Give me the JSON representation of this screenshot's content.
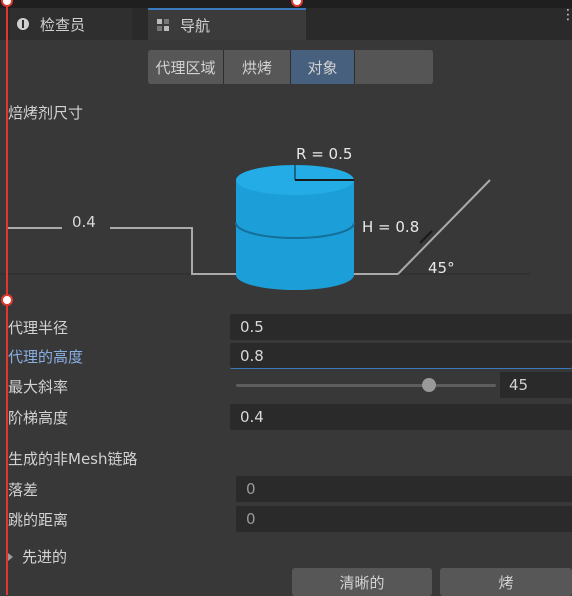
{
  "tabs": [
    {
      "label": "检查员"
    },
    {
      "label": "导航"
    }
  ],
  "segments": [
    "代理区域",
    "烘烤",
    "对象",
    ""
  ],
  "section_bake_title": "焙烤剂尺寸",
  "diagram": {
    "radius_label": "R = 0.5",
    "height_label": "H = 0.8",
    "step_label": "0.4",
    "slope_label": "45°"
  },
  "fields": {
    "agent_radius": {
      "label": "代理半径",
      "value": "0.5"
    },
    "agent_height": {
      "label": "代理的高度",
      "value": "0.8"
    },
    "max_slope": {
      "label": "最大斜率",
      "value": "45",
      "fraction": 0.75
    },
    "step_height": {
      "label": "阶梯高度",
      "value": "0.4"
    }
  },
  "section_links_title": "生成的非Mesh链路",
  "links": {
    "drop_height": {
      "label": "落差",
      "value": "0"
    },
    "jump_distance": {
      "label": "跳的距离",
      "value": "0"
    }
  },
  "advanced_label": "先进的",
  "buttons": {
    "clear": "清晰的",
    "bake": "烤"
  },
  "colors": {
    "accent": "#3a79bb",
    "cylinder": "#1c9fd8",
    "guide": "#e0382e"
  }
}
